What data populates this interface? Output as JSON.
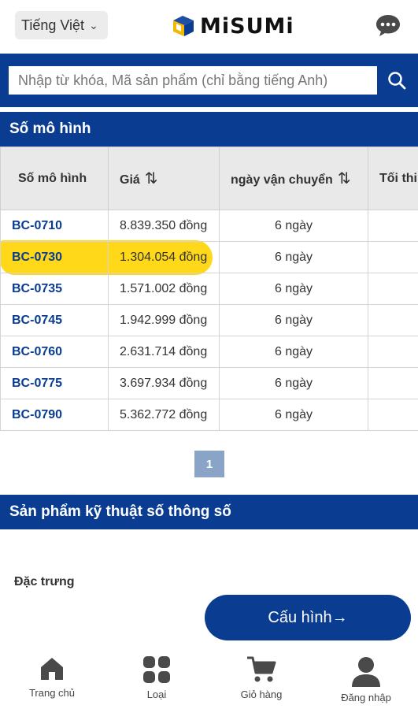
{
  "header": {
    "language": "Tiếng Việt",
    "logo_text": "MiSUMi"
  },
  "search": {
    "placeholder": "Nhập từ khóa, Mã sản phẩm (chỉ bằng tiếng Anh)"
  },
  "model_section": {
    "title": "Số mô hình",
    "columns": [
      "Số mô hình",
      "Giá",
      "ngày vận chuyển",
      "Tối thi"
    ],
    "rows": [
      {
        "model": "BC-0710",
        "price": "8.839.350 đồng",
        "ship": "6 ngày"
      },
      {
        "model": "BC-0730",
        "price": "1.304.054 đồng",
        "ship": "6 ngày"
      },
      {
        "model": "BC-0735",
        "price": "1.571.002 đồng",
        "ship": "6 ngày"
      },
      {
        "model": "BC-0745",
        "price": "1.942.999 đồng",
        "ship": "6 ngày"
      },
      {
        "model": "BC-0760",
        "price": "2.631.714 đồng",
        "ship": "6 ngày"
      },
      {
        "model": "BC-0775",
        "price": "3.697.934 đồng",
        "ship": "6 ngày"
      },
      {
        "model": "BC-0790",
        "price": "5.362.772 đồng",
        "ship": "6 ngày"
      }
    ],
    "page": "1"
  },
  "spec_section": {
    "title": "Sản phẩm kỹ thuật số thông số",
    "feature_label": "Đặc trưng",
    "config_button": "Cấu hình→"
  },
  "bottom_nav": [
    {
      "label": "Trang chủ",
      "icon": "home-icon"
    },
    {
      "label": "Loại",
      "icon": "category-grid-icon"
    },
    {
      "label": "Giỏ hàng",
      "icon": "cart-icon"
    },
    {
      "label": "Đăng nhập",
      "icon": "user-icon"
    }
  ],
  "colors": {
    "brand_blue": "#0a3d91",
    "highlight_yellow": "#ffd400"
  }
}
